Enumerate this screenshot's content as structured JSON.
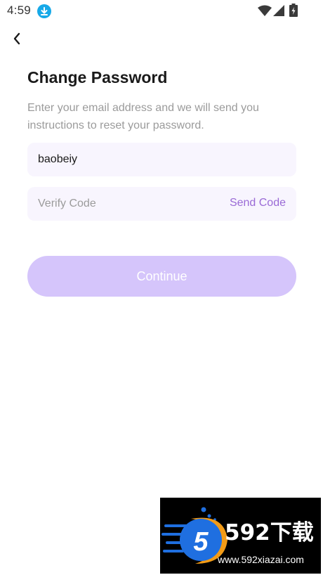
{
  "status_bar": {
    "time": "4:59",
    "icons": [
      "download-icon",
      "wifi-icon",
      "signal-icon",
      "battery-icon"
    ]
  },
  "header": {
    "back_icon": "chevron-left-icon"
  },
  "main": {
    "title": "Change Password",
    "description": "Enter your email address and we will send you instructions to reset your password.",
    "email_value": "baobeiy",
    "code_placeholder": "Verify Code",
    "send_code_label": "Send Code",
    "continue_label": "Continue"
  },
  "colors": {
    "accent": "#9a6ad6",
    "button_disabled": "#d5c5fb",
    "field_bg": "#f8f5fe",
    "download_badge": "#17a9e8"
  },
  "watermark": {
    "brand": "592下载",
    "url": "www.592xiazai.com"
  }
}
